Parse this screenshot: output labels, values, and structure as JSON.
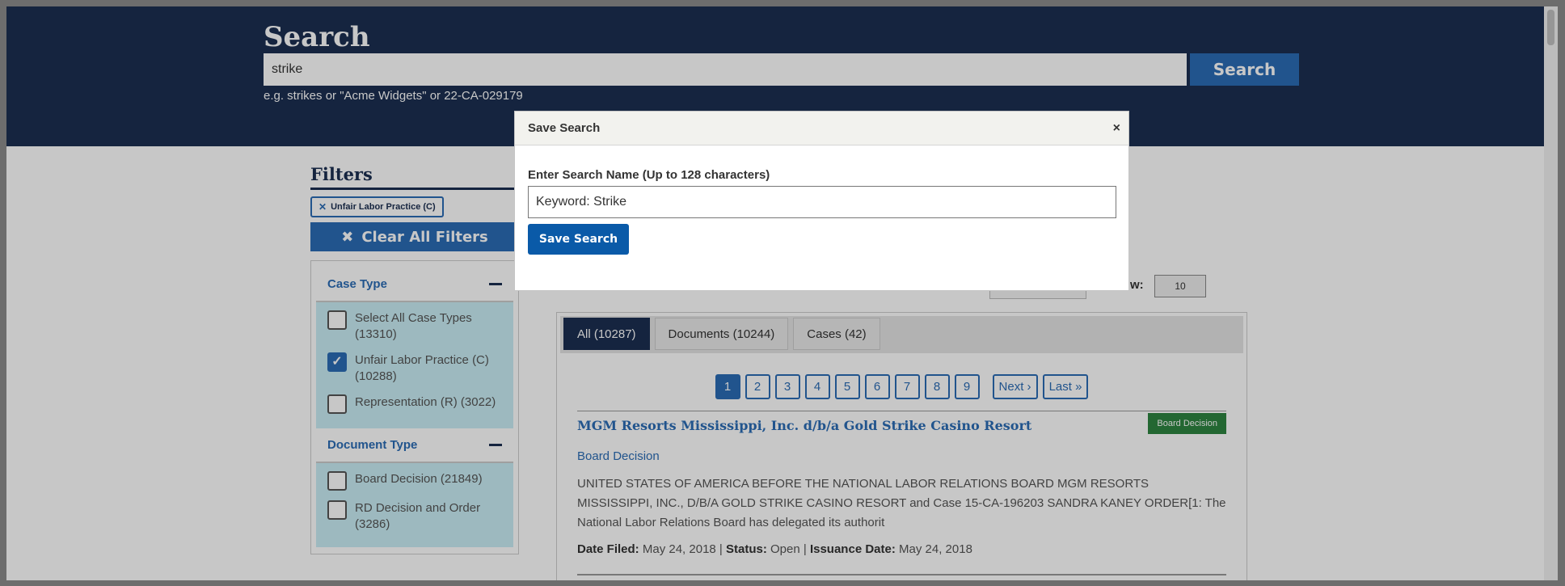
{
  "header": {
    "title": "Search",
    "search_value": "strike",
    "search_button": "Search",
    "hint": "e.g. strikes or \"Acme Widgets\" or 22-CA-029179"
  },
  "filters": {
    "heading": "Filters",
    "active_chip": "Unfair Labor Practice (C)",
    "clear_all": "Clear All Filters",
    "case_type": {
      "title": "Case Type",
      "items": [
        {
          "label": "Select All Case Types (13310)",
          "checked": false
        },
        {
          "label": "Unfair Labor Practice (C) (10288)",
          "checked": true
        },
        {
          "label": "Representation (R) (3022)",
          "checked": false
        }
      ]
    },
    "document_type": {
      "title": "Document Type",
      "items": [
        {
          "label": "Board Decision (21849)",
          "checked": false
        },
        {
          "label": "RD Decision and Order (3286)",
          "checked": false
        }
      ]
    }
  },
  "results": {
    "per_page_label": "w:",
    "per_page_value": "10",
    "tabs": [
      "All (10287)",
      "Documents (10244)",
      "Cases (42)"
    ],
    "pages": [
      "1",
      "2",
      "3",
      "4",
      "5",
      "6",
      "7",
      "8",
      "9"
    ],
    "next_label": "Next ›",
    "last_label": "Last »",
    "item": {
      "title": "MGM Resorts Mississippi, Inc. d/b/a Gold Strike Casino Resort",
      "badge": "Board Decision",
      "type": "Board Decision",
      "snippet": "UNITED STATES OF AMERICA BEFORE THE NATIONAL LABOR RELATIONS BOARD MGM RESORTS MISSISSIPPI, INC., D/B/A GOLD STRIKE CASINO RESORT and Case 15-CA-196203 SANDRA KANEY ORDER[1: The National Labor Relations Board has delegated its authorit",
      "date_filed_label": "Date Filed:",
      "date_filed": "May 24, 2018",
      "status_label": "Status:",
      "status": "Open",
      "issuance_label": "Issuance Date:",
      "issuance_date": "May 24, 2018"
    }
  },
  "modal": {
    "title": "Save Search",
    "close": "×",
    "label": "Enter Search Name (Up to 128 characters)",
    "input_value": "Keyword: Strike",
    "save_button": "Save Search"
  },
  "colors": {
    "header_bg": "#1b2f51",
    "accent": "#2b6cb5",
    "badge": "#2e8540",
    "facet_bg": "#c9eef5"
  }
}
